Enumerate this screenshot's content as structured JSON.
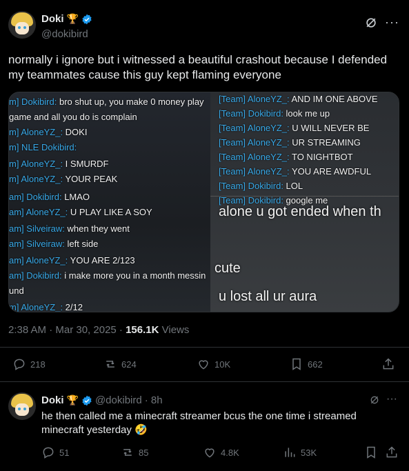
{
  "post": {
    "author_name": "Doki",
    "author_badge": "🏆",
    "author_handle": "@dokibird",
    "text": "normally i ignore but i witnessed a beautiful crashout because I defended my teammates cause this guy kept flaming everyone",
    "timestamp": "2:38 AM · Mar 30, 2025 · ",
    "views_count": "156.1K",
    "views_label": " Views",
    "actions": {
      "replies": "218",
      "reposts": "624",
      "likes": "10K",
      "bookmarks": "662"
    }
  },
  "media": {
    "left_chat": [
      {
        "tag": "m] Dokibird",
        "sep": ": ",
        "msg": "bro shut up, you make 0 money play"
      },
      {
        "tag": "",
        "sep": "",
        "msg": "game and all you do is complain"
      },
      {
        "tag": "m] AloneYZ_",
        "sep": ": ",
        "msg": "DOKI"
      },
      {
        "tag": "m] NLE Dokibird",
        "sep": ":",
        "msg": ""
      },
      {
        "tag": "m] AloneYZ_",
        "sep": ": ",
        "msg": "I SMURDF"
      },
      {
        "tag": "m] AloneYZ_",
        "sep": ": ",
        "msg": "YOUR PEAK"
      },
      {
        "tag": "am] Dokibird",
        "sep": ": ",
        "msg": "LMAO"
      },
      {
        "tag": "am] AloneYZ_",
        "sep": ": ",
        "msg": "U PLAY LIKE A SOY"
      },
      {
        "tag": "am] Silveiraw",
        "sep": ": ",
        "msg": "when they went"
      },
      {
        "tag": "am] Silveiraw",
        "sep": ": ",
        "msg": "left side"
      },
      {
        "tag": "am] AloneYZ_",
        "sep": ": ",
        "msg": "YOU ARE 2/123"
      },
      {
        "tag": "am] Dokibird",
        "sep": ": ",
        "msg": "i make more you in a month messin"
      },
      {
        "tag": "",
        "sep": "",
        "msg": "und"
      },
      {
        "tag": "m] AloneYZ_",
        "sep": ": ",
        "msg": "2/12"
      }
    ],
    "right_chat": [
      {
        "tag": "[Team] AloneYZ_",
        "sep": ": ",
        "msg": "AND IM ONE ABOVE"
      },
      {
        "tag": "[Team] Dokibird",
        "sep": ": ",
        "msg": "look me up"
      },
      {
        "tag": "[Team] AloneYZ_",
        "sep": ": ",
        "msg": "U WILL NEVER BE"
      },
      {
        "tag": "[Team] AloneYZ_",
        "sep": ": ",
        "msg": "UR STREAMING"
      },
      {
        "tag": "[Team] AloneYZ_",
        "sep": ": ",
        "msg": "TO NIGHTBOT"
      },
      {
        "tag": "[Team] AloneYZ_",
        "sep": ": ",
        "msg": "YOU ARE AWDFUL"
      },
      {
        "tag": "[Team] Dokibird",
        "sep": ": ",
        "msg": "LOL"
      },
      {
        "tag": "[Team] Dokibird",
        "sep": ": ",
        "msg": "google me"
      }
    ],
    "caption_1": "alone u got ended when th",
    "caption_2": "cute",
    "caption_3": "u lost all ur aura"
  },
  "reply": {
    "author_name": "Doki",
    "author_badge": "🏆",
    "author_handle": "@dokibird",
    "time": "· 8h",
    "text": "he then called me a minecraft streamer bcus the one time i streamed minecraft yesterday 🤣",
    "actions": {
      "replies": "51",
      "reposts": "85",
      "likes": "4.8K",
      "views": "53K"
    }
  },
  "colors": {
    "accent": "#1d9bf0",
    "chat_tag": "#38a9e8",
    "muted": "#71767b"
  }
}
